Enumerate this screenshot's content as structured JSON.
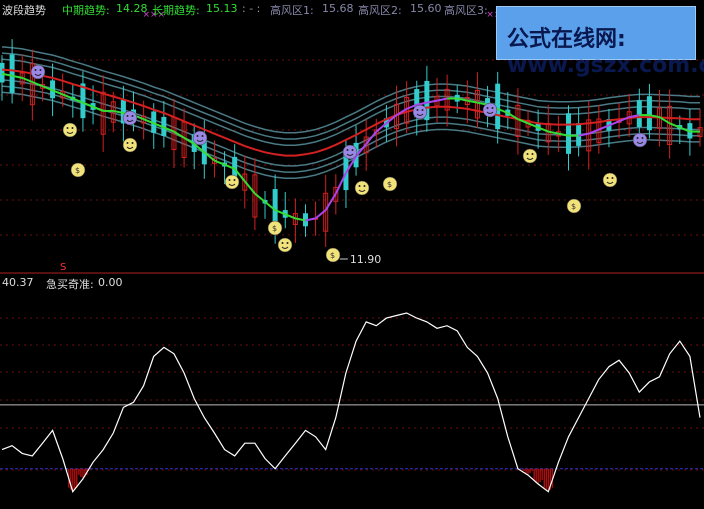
{
  "colors": {
    "background": "#000000",
    "mid_trend": "#33dd33",
    "long_trend": "#d42020",
    "high_risk": "#aa44ee",
    "candle_up": "#d42020",
    "candle_down": "#33cccc",
    "channel": "#4a7a85",
    "oscillator": "#ffffff",
    "buy_bar": "#cc1111",
    "zero_line": "#3333cc",
    "mid_line": "#bbbbbb"
  },
  "header": {
    "indicator_name": "波段趋势",
    "mid_label": "中期趋势:",
    "mid_value": "14.28",
    "long_label": "长期趋势:",
    "long_value": "15.13",
    "dash": ": - :",
    "risk1_label": "高风区1:",
    "risk1_value": "15.68",
    "risk2_label": "高风区2:",
    "risk2_value": "15.60",
    "risk3_label": "高风区3:"
  },
  "watermark": "公式在线网: www.gszx.com.cn",
  "icons": {
    "top_markers": "x-marker-icon",
    "sell_marker": "purple-face-icon",
    "buy_marker": "smiley-face-icon",
    "money_marker": "money-bag-icon"
  },
  "lower_panel": {
    "left_value": "40.37",
    "indicator_label": "急买奇准:",
    "indicator_value": "0.00",
    "marker_s": "S"
  },
  "chart_data": [
    {
      "type": "line",
      "panel": "upper",
      "title": "波段趋势",
      "annotations": [
        {
          "text": "11.90",
          "x": 33
        }
      ],
      "x": [
        0,
        1,
        2,
        3,
        4,
        5,
        6,
        7,
        8,
        9,
        10,
        11,
        12,
        13,
        14,
        15,
        16,
        17,
        18,
        19,
        20,
        21,
        22,
        23,
        24,
        25,
        26,
        27,
        28,
        29,
        30,
        31,
        32,
        33,
        34,
        35,
        36,
        37,
        38,
        39,
        40,
        41,
        42,
        43,
        44,
        45,
        46,
        47,
        48,
        49,
        50,
        51,
        52,
        53,
        54,
        55,
        56,
        57,
        58,
        59,
        60,
        61,
        62,
        63,
        64,
        65,
        66,
        67,
        68,
        69
      ],
      "series": [
        {
          "name": "中期趋势",
          "values": [
            16.2,
            16.15,
            16.1,
            16.0,
            15.9,
            15.8,
            15.7,
            15.6,
            15.5,
            15.4,
            15.3,
            15.3,
            15.25,
            15.2,
            15.1,
            15.0,
            14.9,
            14.8,
            14.65,
            14.5,
            14.3,
            14.1,
            14.0,
            13.9,
            13.6,
            13.3,
            13.1,
            12.9,
            12.8,
            12.7,
            12.65,
            12.7,
            12.9,
            13.3,
            13.8,
            14.2,
            14.5,
            14.8,
            15.0,
            15.2,
            15.35,
            15.45,
            15.5,
            15.55,
            15.6,
            15.6,
            15.55,
            15.5,
            15.45,
            15.35,
            15.25,
            15.1,
            15.0,
            14.9,
            14.8,
            14.75,
            14.7,
            14.7,
            14.75,
            14.85,
            14.95,
            15.05,
            15.15,
            15.2,
            15.2,
            15.15,
            15.0,
            14.9,
            14.8,
            14.8
          ]
        },
        {
          "name": "长期趋势",
          "values": [
            16.3,
            16.28,
            16.25,
            16.2,
            16.15,
            16.1,
            16.03,
            15.95,
            15.88,
            15.8,
            15.72,
            15.65,
            15.58,
            15.5,
            15.42,
            15.33,
            15.25,
            15.15,
            15.05,
            14.95,
            14.85,
            14.75,
            14.65,
            14.55,
            14.45,
            14.37,
            14.3,
            14.25,
            14.22,
            14.22,
            14.25,
            14.3,
            14.38,
            14.48,
            14.6,
            14.72,
            14.85,
            14.98,
            15.1,
            15.2,
            15.28,
            15.34,
            15.38,
            15.4,
            15.4,
            15.38,
            15.35,
            15.3,
            15.25,
            15.2,
            15.15,
            15.1,
            15.05,
            15.0,
            14.98,
            14.97,
            14.97,
            14.98,
            15.0,
            15.03,
            15.07,
            15.1,
            15.13,
            15.15,
            15.15,
            15.14,
            15.13,
            15.12,
            15.1,
            15.1
          ]
        }
      ],
      "ylim": [
        11.5,
        17.5
      ]
    },
    {
      "type": "line",
      "panel": "lower",
      "title": "急买奇准",
      "x": [
        0,
        1,
        2,
        3,
        4,
        5,
        6,
        7,
        8,
        9,
        10,
        11,
        12,
        13,
        14,
        15,
        16,
        17,
        18,
        19,
        20,
        21,
        22,
        23,
        24,
        25,
        26,
        27,
        28,
        29,
        30,
        31,
        32,
        33,
        34,
        35,
        36,
        37,
        38,
        39,
        40,
        41,
        42,
        43,
        44,
        45,
        46,
        47,
        48,
        49,
        50,
        51,
        52,
        53,
        54,
        55,
        56,
        57,
        58,
        59,
        60,
        61,
        62,
        63,
        64,
        65,
        66,
        67,
        68,
        69
      ],
      "series": [
        {
          "name": "急买奇准",
          "values": [
            15,
            18,
            12,
            10,
            20,
            30,
            8,
            -18,
            -8,
            5,
            15,
            28,
            48,
            52,
            65,
            88,
            95,
            90,
            75,
            55,
            40,
            28,
            15,
            10,
            20,
            20,
            8,
            0,
            10,
            20,
            30,
            25,
            15,
            40,
            75,
            100,
            115,
            112,
            118,
            120,
            122,
            118,
            115,
            110,
            112,
            108,
            95,
            88,
            75,
            55,
            25,
            0,
            -5,
            -12,
            -18,
            5,
            25,
            40,
            55,
            70,
            80,
            85,
            75,
            60,
            68,
            72,
            90,
            100,
            88,
            40
          ]
        }
      ],
      "levels": {
        "mid": 50,
        "zero": 0
      },
      "ylim": [
        -30,
        140
      ]
    }
  ]
}
